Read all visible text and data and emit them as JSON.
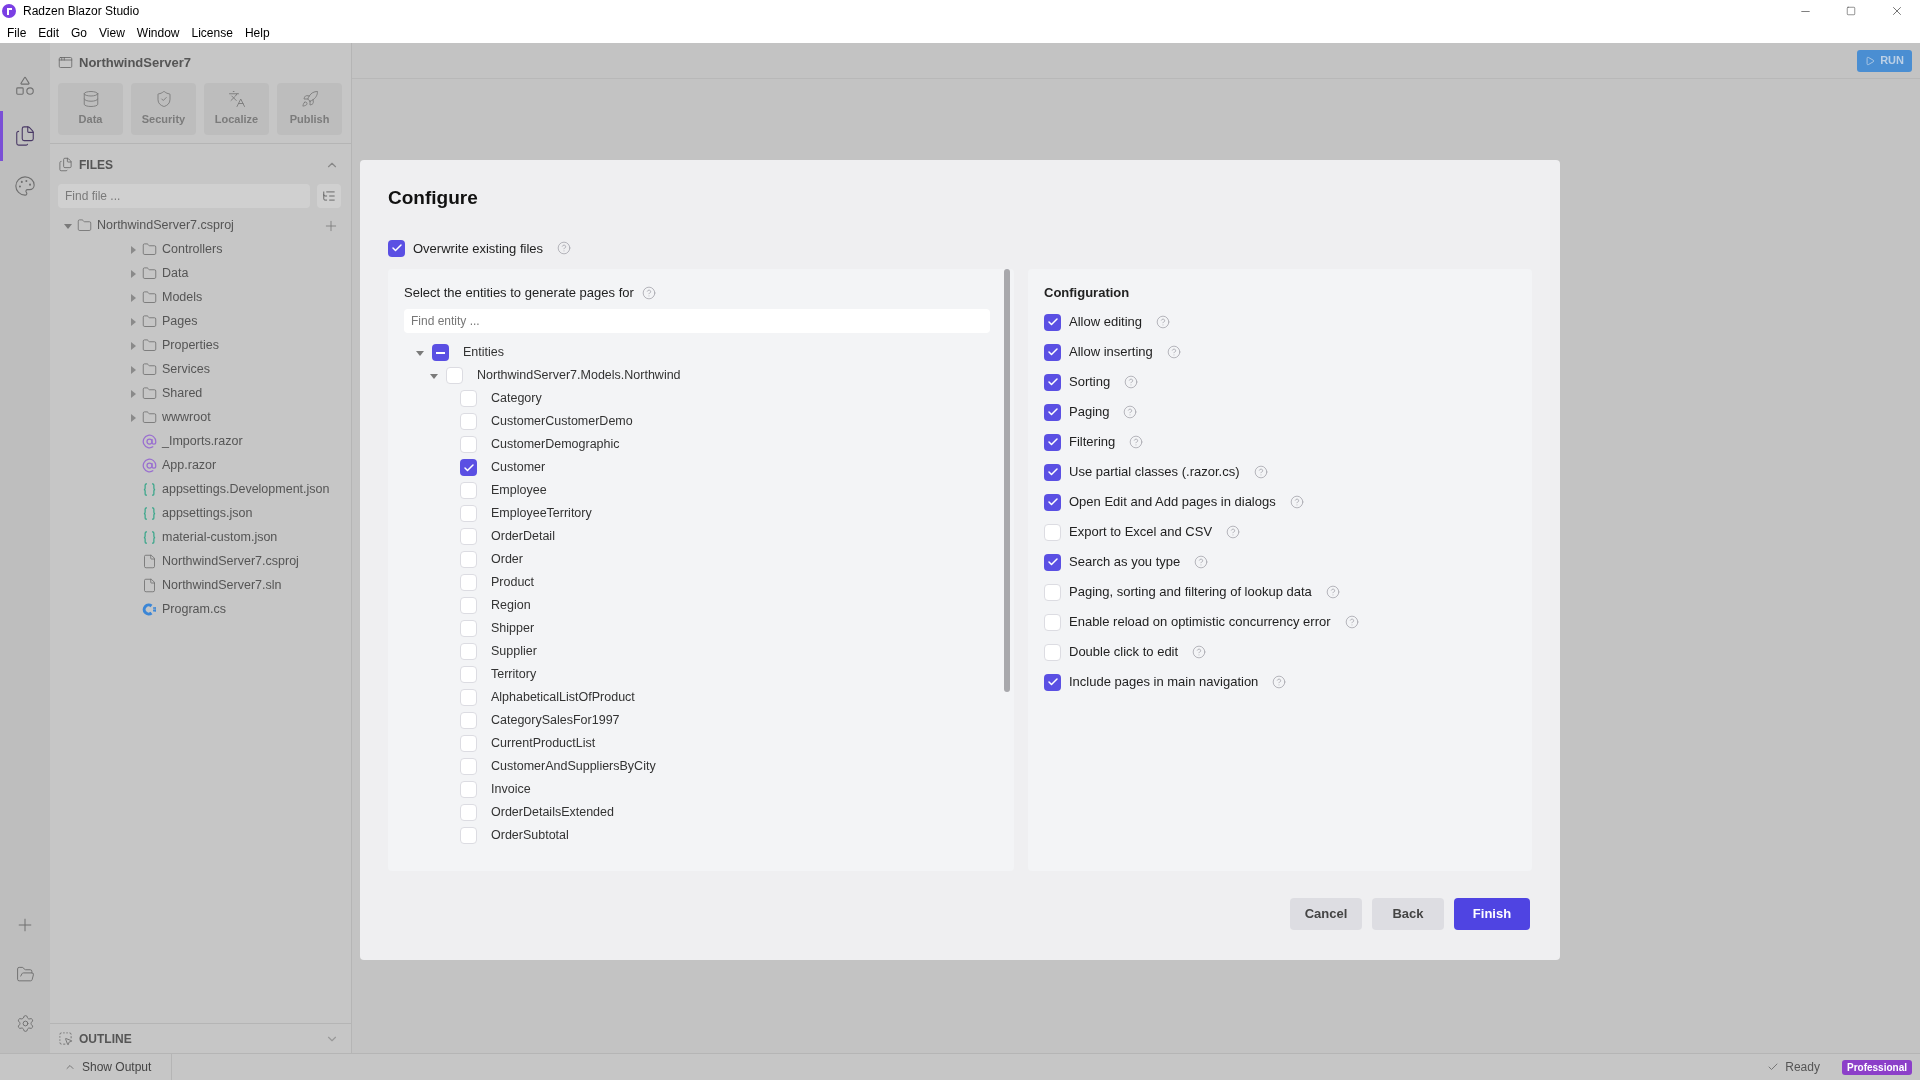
{
  "window": {
    "title": "Radzen Blazor Studio"
  },
  "menu": [
    "File",
    "Edit",
    "Go",
    "View",
    "Window",
    "License",
    "Help"
  ],
  "activity_bar": {
    "top": [
      {
        "kind": "components",
        "selected": false
      },
      {
        "kind": "files",
        "selected": true
      },
      {
        "kind": "theme",
        "selected": false
      }
    ]
  },
  "sidebar": {
    "project": "NorthwindServer7",
    "tools": [
      {
        "kind": "data",
        "label": "Data"
      },
      {
        "kind": "security",
        "label": "Security"
      },
      {
        "kind": "localize",
        "label": "Localize"
      },
      {
        "kind": "publish",
        "label": "Publish"
      }
    ],
    "files": {
      "title": "FILES",
      "search_placeholder": "Find file ...",
      "tree": {
        "label": "NorthwindServer7.csproj",
        "expanded": true,
        "children": [
          {
            "label": "Controllers",
            "kind": "folder",
            "expanded": false
          },
          {
            "label": "Data",
            "kind": "folder",
            "expanded": false
          },
          {
            "label": "Models",
            "kind": "folder",
            "expanded": false
          },
          {
            "label": "Pages",
            "kind": "folder",
            "expanded": false
          },
          {
            "label": "Properties",
            "kind": "folder",
            "expanded": false
          },
          {
            "label": "Services",
            "kind": "folder",
            "expanded": false
          },
          {
            "label": "Shared",
            "kind": "folder",
            "expanded": false
          },
          {
            "label": "wwwroot",
            "kind": "folder",
            "expanded": false
          },
          {
            "label": "_Imports.razor",
            "kind": "razor"
          },
          {
            "label": "App.razor",
            "kind": "razor"
          },
          {
            "label": "appsettings.Development.json",
            "kind": "json"
          },
          {
            "label": "appsettings.json",
            "kind": "json"
          },
          {
            "label": "material-custom.json",
            "kind": "json"
          },
          {
            "label": "NorthwindServer7.csproj",
            "kind": "file"
          },
          {
            "label": "NorthwindServer7.sln",
            "kind": "file"
          },
          {
            "label": "Program.cs",
            "kind": "csharp"
          }
        ]
      }
    },
    "outline": {
      "title": "OUTLINE"
    }
  },
  "toolbar": {
    "run": "RUN"
  },
  "dialog": {
    "title": "Configure",
    "overwrite": {
      "label": "Overwrite existing files",
      "checked": true
    },
    "entities": {
      "heading": "Select the entities to generate pages for",
      "search_placeholder": "Find entity ...",
      "tree": {
        "label": "Entities",
        "indeterminate": true,
        "expanded": true,
        "children": [
          {
            "label": "NorthwindServer7.Models.Northwind",
            "checked": false,
            "expanded": true,
            "children": [
              {
                "label": "Category",
                "checked": false
              },
              {
                "label": "CustomerCustomerDemo",
                "checked": false
              },
              {
                "label": "CustomerDemographic",
                "checked": false
              },
              {
                "label": "Customer",
                "checked": true
              },
              {
                "label": "Employee",
                "checked": false
              },
              {
                "label": "EmployeeTerritory",
                "checked": false
              },
              {
                "label": "OrderDetail",
                "checked": false
              },
              {
                "label": "Order",
                "checked": false
              },
              {
                "label": "Product",
                "checked": false
              },
              {
                "label": "Region",
                "checked": false
              },
              {
                "label": "Shipper",
                "checked": false
              },
              {
                "label": "Supplier",
                "checked": false
              },
              {
                "label": "Territory",
                "checked": false
              },
              {
                "label": "AlphabeticalListOfProduct",
                "checked": false
              },
              {
                "label": "CategorySalesFor1997",
                "checked": false
              },
              {
                "label": "CurrentProductList",
                "checked": false
              },
              {
                "label": "CustomerAndSuppliersByCity",
                "checked": false
              },
              {
                "label": "Invoice",
                "checked": false
              },
              {
                "label": "OrderDetailsExtended",
                "checked": false
              },
              {
                "label": "OrderSubtotal",
                "checked": false
              }
            ]
          }
        ]
      }
    },
    "configuration": {
      "heading": "Configuration",
      "options": [
        {
          "label": "Allow editing",
          "checked": true
        },
        {
          "label": "Allow inserting",
          "checked": true
        },
        {
          "label": "Sorting",
          "checked": true
        },
        {
          "label": "Paging",
          "checked": true
        },
        {
          "label": "Filtering",
          "checked": true
        },
        {
          "label": "Use partial classes (.razor.cs)",
          "checked": true
        },
        {
          "label": "Open Edit and Add pages in dialogs",
          "checked": true
        },
        {
          "label": "Export to Excel and CSV",
          "checked": false
        },
        {
          "label": "Search as you type",
          "checked": true
        },
        {
          "label": "Paging, sorting and filtering of lookup data",
          "checked": false
        },
        {
          "label": "Enable reload on optimistic concurrency error",
          "checked": false
        },
        {
          "label": "Double click to edit",
          "checked": false
        },
        {
          "label": "Include pages in main navigation",
          "checked": true
        }
      ]
    },
    "buttons": [
      {
        "label": "Cancel",
        "kind": "secondary"
      },
      {
        "label": "Back",
        "kind": "secondary"
      },
      {
        "label": "Finish",
        "kind": "primary"
      }
    ]
  },
  "status_bar": {
    "output": "Show Output",
    "status": "Ready",
    "license": "Professional"
  }
}
